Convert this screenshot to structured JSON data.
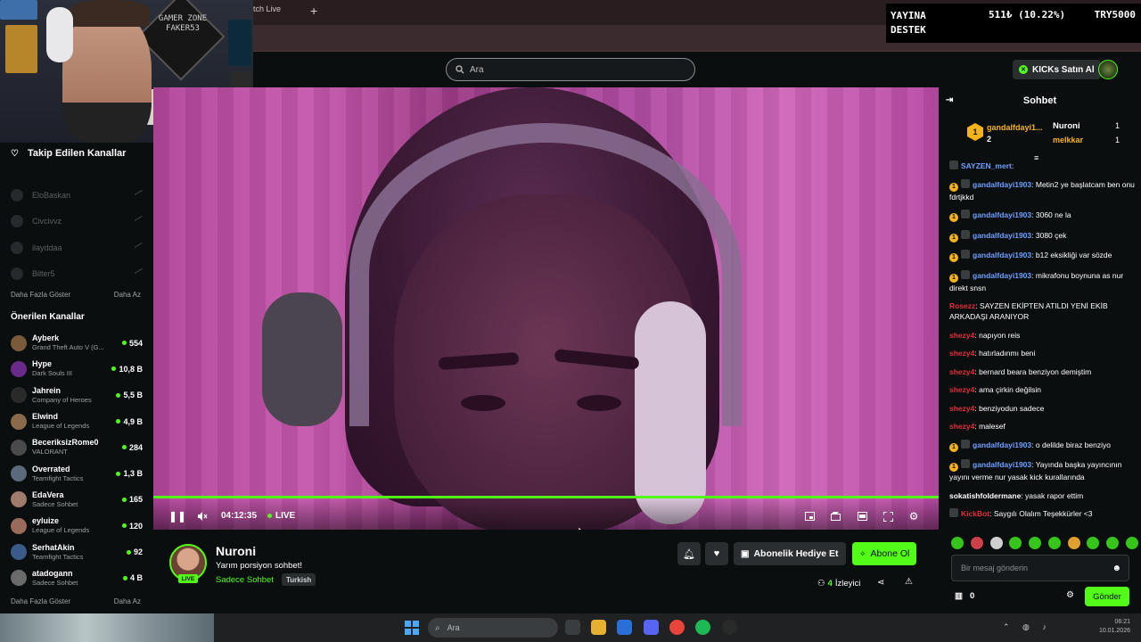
{
  "browser": {
    "tab_partial": "tch Live",
    "new_tab_symbol": "+"
  },
  "header": {
    "search_placeholder": "Ara",
    "kicks_label": "KICKs Satın Al"
  },
  "donation_overlay": {
    "label_line1": "YAYINA",
    "label_line2": "DESTEK",
    "amount": "511₺ (10.22%)",
    "goal": "TRY5000"
  },
  "webcam": {
    "sign_text": "GAMER ZONE FAKER53"
  },
  "sidebar": {
    "followed_title": "Takip Edilen Kanallar",
    "followed": [
      {
        "name": "EloBaskan"
      },
      {
        "name": "Civcivvz"
      },
      {
        "name": "ilayddaa"
      },
      {
        "name": "Bilter5"
      }
    ],
    "show_more": "Daha Fazla Göster",
    "show_less": "Daha Az",
    "recommended_title": "Önerilen Kanallar",
    "recommended": [
      {
        "name": "Ayberk",
        "category": "Grand Theft Auto V (G...",
        "viewers": "554",
        "color": "#7a5a3a"
      },
      {
        "name": "Hype",
        "category": "Dark Souls III",
        "viewers": "10,8 B",
        "color": "#6a2a8a"
      },
      {
        "name": "Jahrein",
        "category": "Company of Heroes",
        "viewers": "5,5 B",
        "color": "#2a2a2a"
      },
      {
        "name": "Elwind",
        "category": "League of Legends",
        "viewers": "4,9 B",
        "color": "#8a6a4a"
      },
      {
        "name": "BeceriksizRome0",
        "category": "VALORANT",
        "viewers": "284",
        "color": "#4a4a4a"
      },
      {
        "name": "Overrated",
        "category": "Teamfight Tactics",
        "viewers": "1,3 B",
        "color": "#5a6a7a"
      },
      {
        "name": "EdaVera",
        "category": "Sadece Sohbet",
        "viewers": "165",
        "color": "#a07a6a"
      },
      {
        "name": "eyluize",
        "category": "League of Legends",
        "viewers": "120",
        "color": "#9a6a5a"
      },
      {
        "name": "SerhatAkin",
        "category": "Teamfight Tactics",
        "viewers": "92",
        "color": "#3a5a8a"
      },
      {
        "name": "atadogann",
        "category": "Sadece Sohbet",
        "viewers": "4 B",
        "color": "#6a6a6a"
      }
    ]
  },
  "player": {
    "time": "04:12:35",
    "live_label": "LIVE"
  },
  "stream": {
    "streamer": "Nuroni",
    "title": "Yarım porsiyon sohbet!",
    "category": "Sadece Sohbet",
    "language": "Turkish",
    "live_badge": "LIVE",
    "gift_label": "Abonelik Hediye Et",
    "subscribe_label": "Abone Ol",
    "viewer_count": "4",
    "viewer_label": "İzleyici"
  },
  "chat": {
    "title": "Sohbet",
    "leaderboard": {
      "first_rank": "1",
      "first_user": "gandalfdayi1...",
      "first_count": "2",
      "second_user": "Nuroni",
      "second_count": "1",
      "third_user": "melkkar",
      "third_count": "1"
    },
    "messages": [
      {
        "user": "SAYZEN_mert",
        "text": "",
        "color": "#6fa0ff",
        "badge": "",
        "sub": true
      },
      {
        "user": "gandalfdayi1903",
        "text": "Metin2 ye başlatcam ben onu fdrtjkkd",
        "color": "#6fa0ff",
        "badge": "1",
        "sub": true
      },
      {
        "user": "gandalfdayi1903",
        "text": "3060 ne la",
        "color": "#6fa0ff",
        "badge": "1",
        "sub": true
      },
      {
        "user": "gandalfdayi1903",
        "text": "3080 çek",
        "color": "#6fa0ff",
        "badge": "1",
        "sub": true
      },
      {
        "user": "gandalfdayi1903",
        "text": "b12 eksikliği var sözde",
        "color": "#6fa0ff",
        "badge": "1",
        "sub": true
      },
      {
        "user": "gandalfdayi1903",
        "text": "mikrafonu boynuna as nur direkt snsn",
        "color": "#6fa0ff",
        "badge": "1",
        "sub": true
      },
      {
        "user": "Rosezz",
        "text": "SAYZEN EKİPTEN ATILDI YENİ EKİB ARKADAŞI ARANIYOR",
        "color": "#e0303a",
        "badge": "",
        "sub": false
      },
      {
        "user": "shezy4",
        "text": "napıyon reis",
        "color": "#e0303a",
        "badge": "",
        "sub": false
      },
      {
        "user": "shezy4",
        "text": "hatırladınmı beni",
        "color": "#e0303a",
        "badge": "",
        "sub": false
      },
      {
        "user": "shezy4",
        "text": "bernard beara benziyon demiştim",
        "color": "#e0303a",
        "badge": "",
        "sub": false
      },
      {
        "user": "shezy4",
        "text": "ama çirkin değilsin",
        "color": "#e0303a",
        "badge": "",
        "sub": false
      },
      {
        "user": "shezy4",
        "text": "benziyodun sadece",
        "color": "#e0303a",
        "badge": "",
        "sub": false
      },
      {
        "user": "shezy4",
        "text": "malesef",
        "color": "#e0303a",
        "badge": "",
        "sub": false
      },
      {
        "user": "gandalfdayi1903",
        "text": "o delilde biraz benziyo",
        "color": "#6fa0ff",
        "badge": "1",
        "sub": true
      },
      {
        "user": "gandalfdayi1903",
        "text": "Yayında başka yayıncının yayını verme nur yasak kick kurallarında",
        "color": "#6fa0ff",
        "badge": "1",
        "sub": true
      },
      {
        "user": "sokatishfoldermane",
        "text": "yasak rapor ettim",
        "color": "#ffffff",
        "badge": "",
        "sub": false
      },
      {
        "user": "KickBot",
        "text": "Saygılı Olalım Teşekkürler <3",
        "color": "#e0303a",
        "badge": "",
        "sub": true
      }
    ],
    "input_placeholder": "Bir mesaj gönderin",
    "points": "0",
    "send_label": "Gönder"
  },
  "taskbar": {
    "search_placeholder": "Ara",
    "clock_time": "06:21",
    "clock_date": "10.01.2026"
  }
}
